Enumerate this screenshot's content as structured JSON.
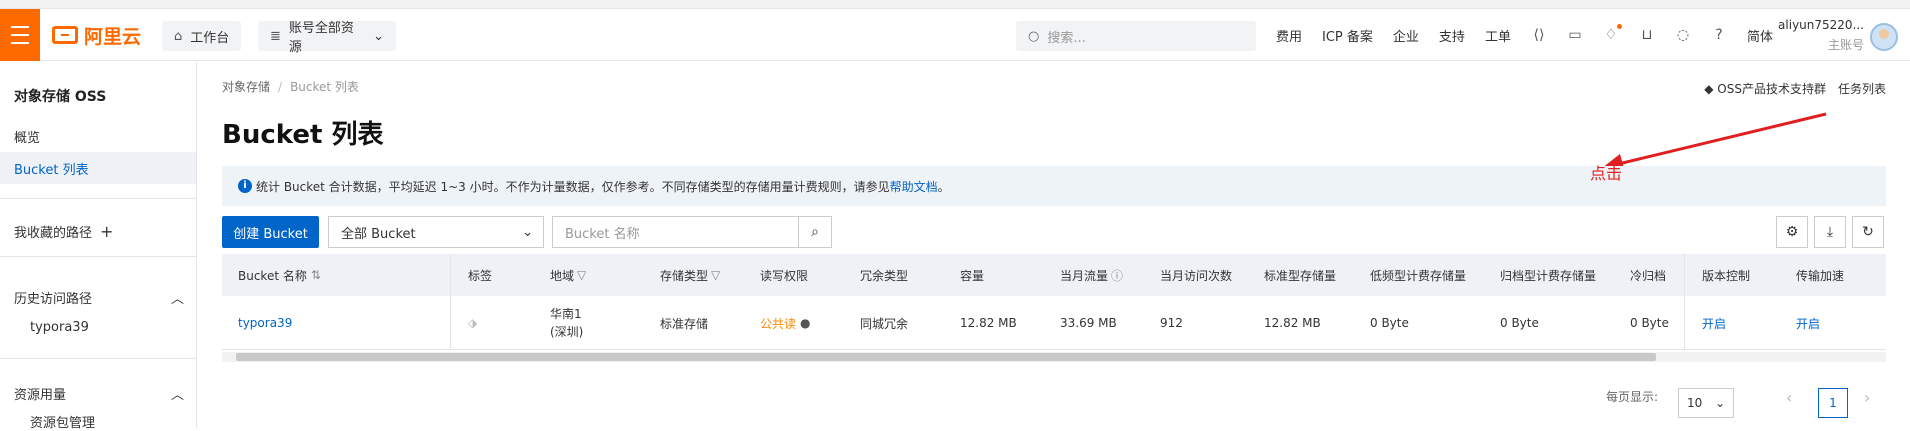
{
  "topbar": {
    "brand": "阿里云",
    "workbench": "工作台",
    "resource_scope": "账号全部资源",
    "search_placeholder": "搜索...",
    "links": [
      "费用",
      "ICP 备案",
      "企业",
      "支持",
      "工单"
    ],
    "lang": "简体",
    "user_name": "aliyun75220...",
    "user_role": "主账号"
  },
  "sidebar": {
    "title": "对象存储 OSS",
    "items": [
      "概览",
      "Bucket 列表"
    ],
    "favorites": "我收藏的路径",
    "history_title": "历史访问路径",
    "history_items": [
      "typora39"
    ],
    "resource_title": "资源用量",
    "resource_items": [
      "资源包管理"
    ]
  },
  "main": {
    "breadcrumb": [
      "对象存储",
      "Bucket 列表"
    ],
    "title": "Bucket 列表",
    "top_links": [
      "OSS产品技术支持群",
      "任务列表"
    ],
    "info_text": "统计 Bucket 合计数据，平均延迟 1~3 小时。不作为计量数据，仅作参考。不同存储类型的存储用量计费规则，请参见",
    "info_link": "帮助文档",
    "info_end": "。",
    "annotation": "点击",
    "create_button": "创建 Bucket",
    "filter_select": "全部 Bucket",
    "name_placeholder": "Bucket 名称"
  },
  "table": {
    "headers": [
      "Bucket 名称",
      "标签",
      "地域",
      "存储类型",
      "读写权限",
      "冗余类型",
      "容量",
      "当月流量",
      "当月访问次数",
      "标准型存储量",
      "低频型计费存储量",
      "归档型计费存储量",
      "冷归档",
      "版本控制",
      "传输加速"
    ],
    "rows": [
      {
        "name": "typora39",
        "region_line1": "华南1",
        "region_line2": "(深圳)",
        "storage_type": "标准存储",
        "acl": "公共读",
        "redundancy": "同城冗余",
        "capacity": "12.82 MB",
        "traffic": "33.69 MB",
        "visits": "912",
        "std_storage": "12.82 MB",
        "ia_storage": "0 Byte",
        "archive_storage": "0 Byte",
        "cold_archive": "0 Byte",
        "versioning": "开启",
        "acceleration": "开启"
      }
    ]
  },
  "pagination": {
    "label": "每页显示:",
    "page_size": "10",
    "current_page": "1"
  },
  "colors": {
    "brand": "#ff6a00",
    "primary": "#0064c8",
    "annotation": "#e02020"
  }
}
